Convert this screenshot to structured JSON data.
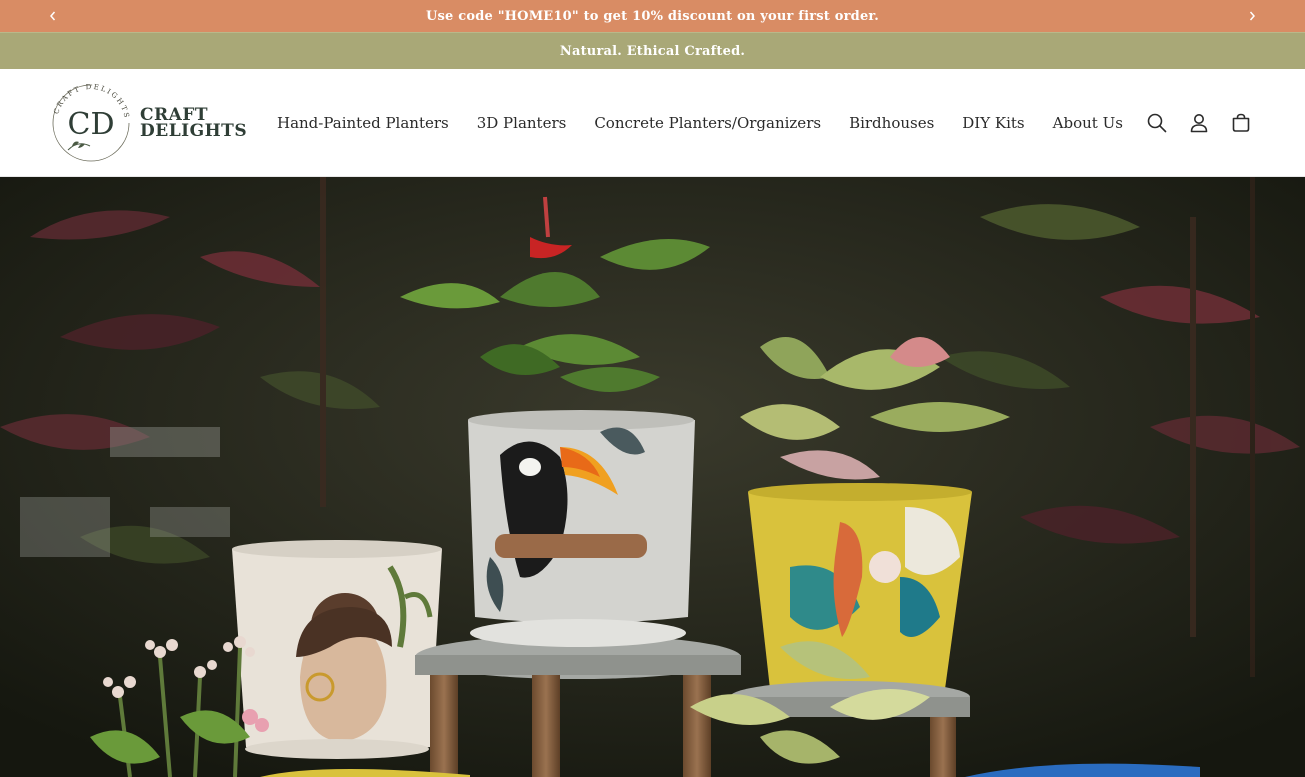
{
  "announcement": {
    "text": "Use code \"HOME10\" to get 10% discount on your first order.",
    "prev_icon": "chevron-left-icon",
    "next_icon": "chevron-right-icon",
    "background": "#d98c64"
  },
  "tagline": {
    "text": "Natural. Ethical Crafted.",
    "background": "#a9a877"
  },
  "brand": {
    "line1": "CRAFT",
    "line2": "DELIGHTS",
    "ring_text": "CRAFT DELIGHTS",
    "monogram": "CD"
  },
  "nav": {
    "items": [
      {
        "label": "Hand-Painted Planters"
      },
      {
        "label": "3D Planters"
      },
      {
        "label": "Concrete Planters/Organizers"
      },
      {
        "label": "Birdhouses"
      },
      {
        "label": "DIY Kits"
      },
      {
        "label": "About Us"
      }
    ]
  },
  "header_icons": {
    "search": "search-icon",
    "account": "account-icon",
    "cart": "cart-icon"
  },
  "hero": {
    "image": "hand-painted-planters-with-plants",
    "colors": {
      "dark_bg": "#1a1d16",
      "yellow_pot": "#d9c23c",
      "grey_pot": "#d3d3cf",
      "cream_pot": "#e8e2d8"
    }
  }
}
